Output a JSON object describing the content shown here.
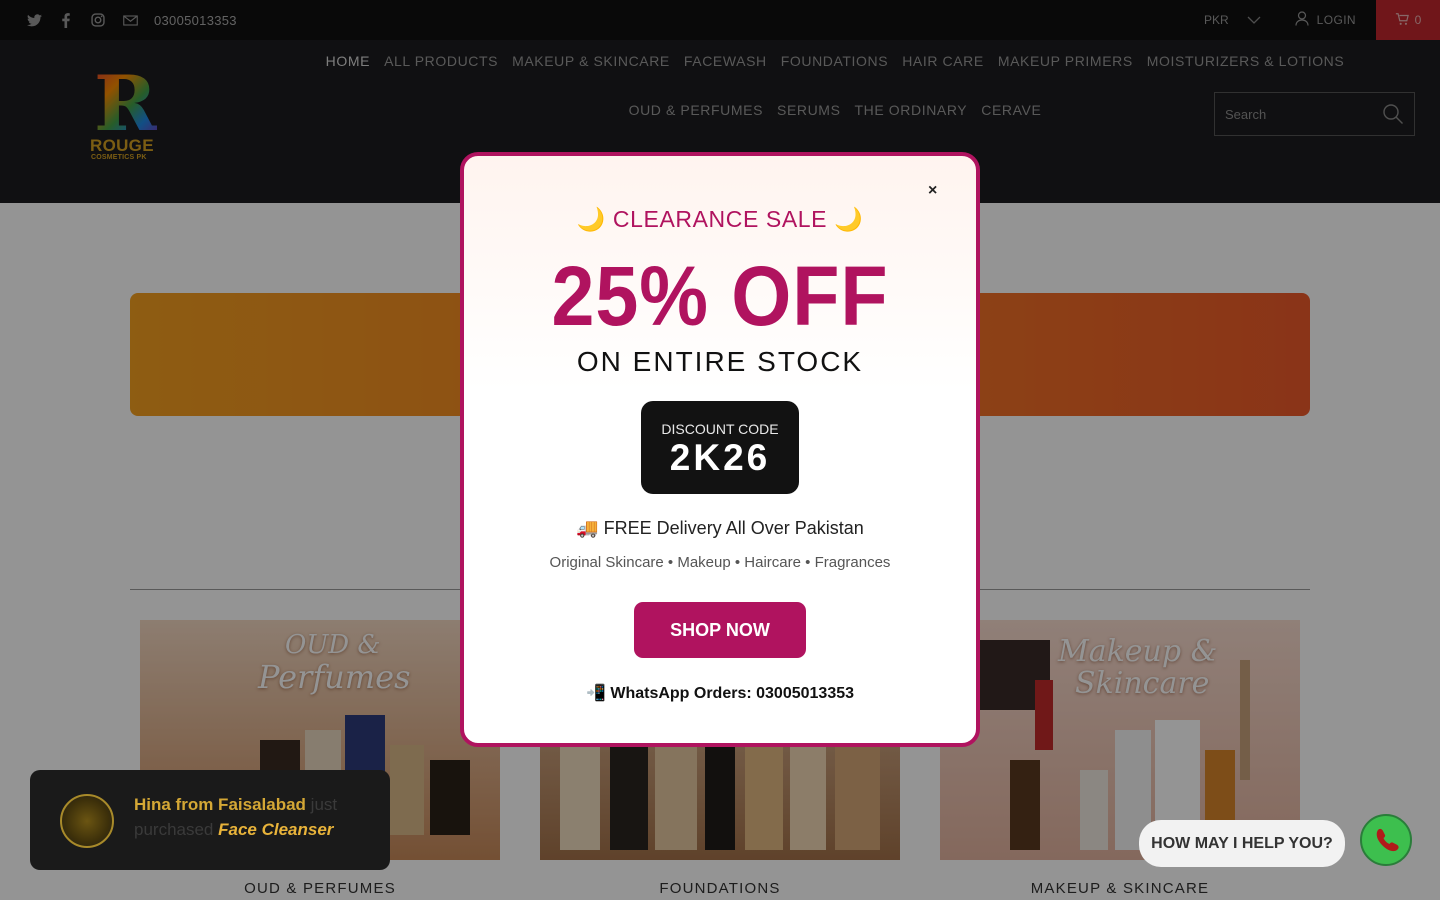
{
  "topbar": {
    "social_icons": [
      "twitter-icon",
      "facebook-icon",
      "instagram-icon",
      "email-icon"
    ],
    "phone": "03005013353",
    "currency": "PKR",
    "login": "LOGIN",
    "cart_count": "0"
  },
  "header": {
    "logo_letter": "R",
    "logo_name": "ROUGE",
    "logo_sub": "COSMETICS PK",
    "nav": [
      "HOME",
      "ALL PRODUCTS",
      "MAKEUP & SKINCARE",
      "FACEWASH",
      "FOUNDATIONS",
      "HAIR CARE",
      "MAKEUP PRIMERS",
      "MOISTURIZERS & LOTIONS",
      "OUD & PERFUMES",
      "SERUMS",
      "THE ORDINARY",
      "CERAVE"
    ],
    "search_placeholder": "Search"
  },
  "tiles": [
    {
      "label": "OUD & PERFUMES",
      "overlay_line1": "OUD &",
      "overlay_line2": "Perfumes"
    },
    {
      "label": "FOUNDATIONS"
    },
    {
      "label": "MAKEUP & SKINCARE",
      "overlay_line1": "Makeup &",
      "overlay_line2": "Skincare"
    }
  ],
  "modal": {
    "close": "×",
    "heading": "🌙 CLEARANCE SALE 🌙",
    "big_offer": "25% OFF",
    "sub_offer": "ON ENTIRE STOCK",
    "code_label": "DISCOUNT CODE",
    "code": "2K26",
    "delivery": "🚚 FREE Delivery All Over Pakistan",
    "categories": "Original Skincare • Makeup • Haircare • Fragrances",
    "cta": "SHOP NOW",
    "whatsapp": "📲 WhatsApp Orders: 03005013353"
  },
  "toast": {
    "name": "Hina from Faisalabad",
    "action": "just purchased",
    "product": "Face Cleanser"
  },
  "chat": {
    "help_text": "HOW MAY I HELP YOU?"
  },
  "colors": {
    "brand": "#b0135f",
    "topbar": "#111111",
    "header": "#1d1d1f",
    "cart": "#c1272d"
  }
}
